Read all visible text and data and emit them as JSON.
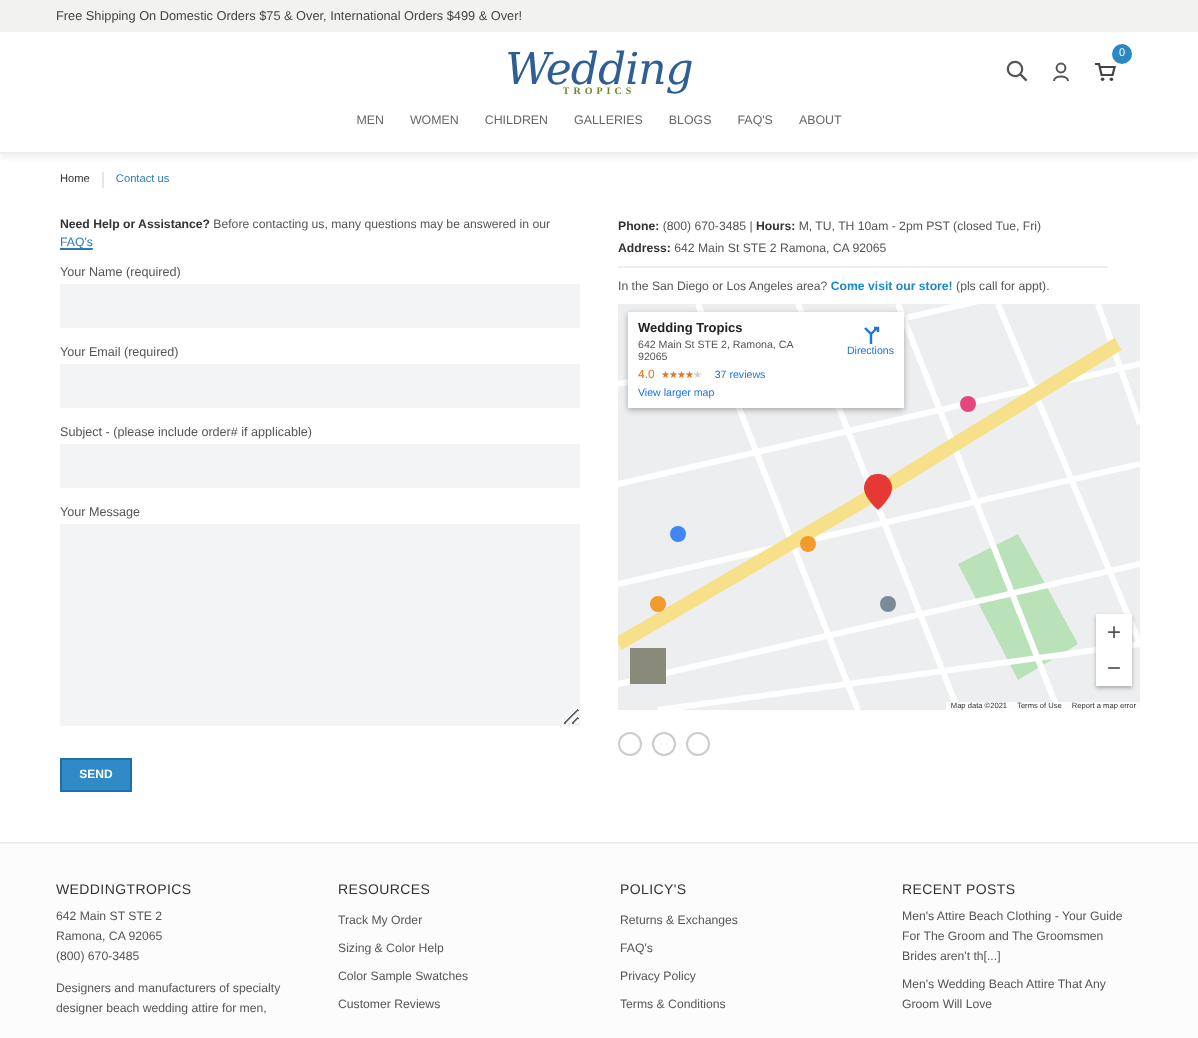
{
  "top_bar": {
    "text": "Free Shipping On Domestic Orders $75 & Over, International Orders $499 & Over!"
  },
  "header": {
    "logo_title": "Wedding",
    "logo_subtitle": "TROPICS",
    "cart_count": "0",
    "nav": [
      "MEN",
      "WOMEN",
      "CHILDREN",
      "GALLERIES",
      "BLOGS",
      "FAQ'S",
      "ABOUT"
    ]
  },
  "breadcrumb": [
    {
      "label": "Home",
      "selected": false
    },
    {
      "label": "Contact us",
      "selected": true
    }
  ],
  "intro": {
    "text": "**Need Help or Assistance?** Before contacting us, many questions may be answered in our",
    "link": "FAQ's"
  },
  "form": {
    "fields": [
      {
        "label": "Your Name (required)",
        "kind": "input"
      },
      {
        "label": "Your Email (required)",
        "kind": "input"
      },
      {
        "label": "Subject - (please include order# if applicable)",
        "kind": "input"
      },
      {
        "label": "Your Message",
        "kind": "textarea"
      }
    ],
    "submit": "SEND"
  },
  "contact": {
    "phone_line": "**Phone:** (800) 670-3485 | **Hours:** M, TU, TH 10am - 2pm PST (closed Tue, Fri)",
    "address_line": "**Address:** 642 Main St STE 2 Ramona, CA 92065",
    "visit_text": "In the San Diego or Los Angeles area?",
    "visit_link": "Come visit our store!",
    "visit_after": "(pls call for appt)."
  },
  "map": {
    "place": "Wedding Tropics",
    "address": "642 Main St STE 2, Ramona, CA 92065",
    "rating": "4.0",
    "stars": 4,
    "reviews": "37 reviews",
    "directions": "Directions",
    "larger_map": "View larger map",
    "zoom_in": "+",
    "zoom_out": "−",
    "attribution": "Map data ©2021",
    "terms": "Terms of Use",
    "report": "Report a map error"
  },
  "footer": {
    "columns": [
      {
        "title": "WEDDINGTROPICS",
        "kind": "about",
        "lines": [
          "642 Main ST STE 2",
          "Ramona, CA 92065",
          "(800) 670-3485"
        ],
        "description": "Designers and manufacturers of specialty designer beach wedding attire for men,"
      },
      {
        "title": "RESOURCES",
        "kind": "links",
        "links": [
          "Track My Order",
          "Sizing & Color Help",
          "Color Sample Swatches",
          "Customer Reviews"
        ]
      },
      {
        "title": "POLICY'S",
        "kind": "links",
        "links": [
          "Returns & Exchanges",
          "FAQ's",
          "Privacy Policy",
          "Terms & Conditions"
        ]
      },
      {
        "title": "RECENT POSTS",
        "kind": "posts",
        "posts": [
          {
            "title": "Men's Attire Beach Clothing - Your Guide For The Groom and The Groomsmen",
            "excerpt": "Brides aren't th[...]"
          },
          {
            "title": "Men's Wedding Beach Attire That Any Groom Will Love"
          }
        ]
      }
    ]
  }
}
